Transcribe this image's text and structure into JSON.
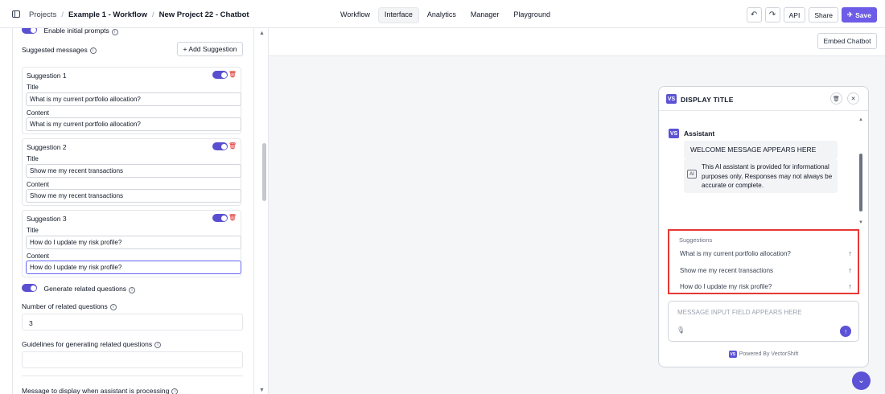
{
  "topbar": {
    "breadcrumbs": [
      "Projects",
      "Example 1 - Workflow",
      "New Project 22 - Chatbot"
    ],
    "tabs": [
      "Workflow",
      "Interface",
      "Analytics",
      "Manager",
      "Playground"
    ],
    "active_tab": "Interface",
    "undo_icon": "undo-icon",
    "redo_icon": "redo-icon",
    "api_label": "API",
    "share_label": "Share",
    "save_label": "Save"
  },
  "left": {
    "enable_initial_prompts": "Enable initial prompts",
    "suggested_messages": "Suggested messages",
    "add_suggestion": "+ Add Suggestion",
    "title_label": "Title",
    "content_label": "Content",
    "suggestions": [
      {
        "name": "Suggestion 1",
        "title": "What is my current portfolio allocation?",
        "content": "What is my current portfolio allocation?"
      },
      {
        "name": "Suggestion 2",
        "title": "Show me my recent transactions",
        "content": "Show me my recent transactions"
      },
      {
        "name": "Suggestion 3",
        "title": "How do I update my risk profile?",
        "content": "How do I update my risk profile?"
      }
    ],
    "generate_related": "Generate related questions",
    "number_related_label": "Number of related questions",
    "number_related_value": "3",
    "guidelines_label": "Guidelines for generating related questions",
    "guidelines_value": "",
    "processing_label": "Message to display when assistant is processing"
  },
  "canvas": {
    "embed_label": "Embed Chatbot",
    "chat": {
      "logo": "VS",
      "title": "DISPLAY TITLE",
      "assistant_name": "Assistant",
      "welcome": "WELCOME MESSAGE APPEARS HERE",
      "ai_badge": "AI",
      "disclaimer": "This AI assistant is provided for informational purposes only. Responses may not always be accurate or complete.",
      "suggestions_heading": "Suggestions",
      "suggestions": [
        "What is my current portfolio allocation?",
        "Show me my recent transactions",
        "How do I update my risk profile?"
      ],
      "input_placeholder": "MESSAGE INPUT FIELD APPEARS HERE",
      "powered_by": "Powered By VectorShift"
    }
  },
  "colors": {
    "accent": "#5b52d6",
    "highlight": "#e53935"
  }
}
